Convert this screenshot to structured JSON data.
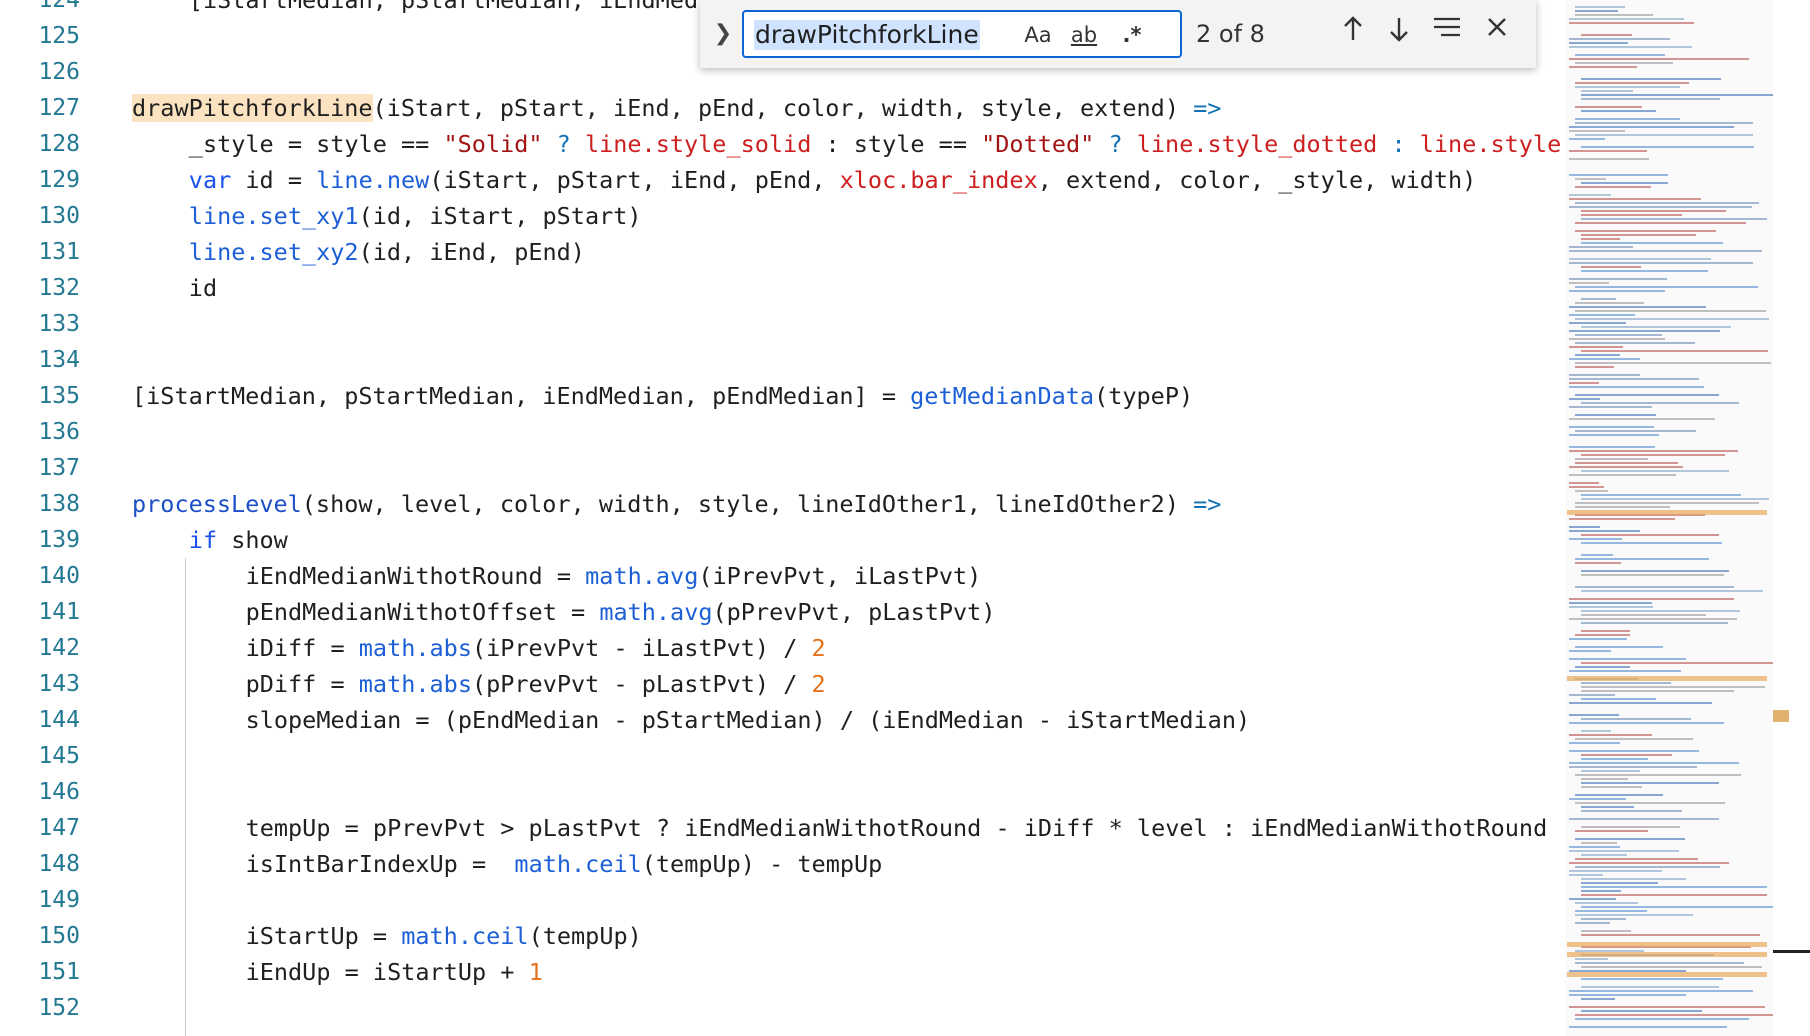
{
  "editor": {
    "lines": [
      {
        "num": "124",
        "indent": 1,
        "tokens": [
          {
            "t": "[iStartMedian, pStartMedian, iEndMed",
            "c": "cl"
          }
        ]
      },
      {
        "num": "125",
        "indent": 0,
        "tokens": []
      },
      {
        "num": "126",
        "indent": 0,
        "tokens": []
      },
      {
        "num": "127",
        "indent": 0,
        "tokens": [
          {
            "t": "drawPitchforkLine",
            "c": "hl"
          },
          {
            "t": "(iStart, pStart, iEnd, pEnd, color, width, style, extend) ",
            "c": "cl"
          },
          {
            "t": "=>",
            "c": "o"
          }
        ]
      },
      {
        "num": "128",
        "indent": 1,
        "tokens": [
          {
            "t": "_style = style == ",
            "c": "cl"
          },
          {
            "t": "\"Solid\"",
            "c": "s"
          },
          {
            "t": " ? ",
            "c": "o"
          },
          {
            "t": "line.style_solid",
            "c": "r"
          },
          {
            "t": " : style == ",
            "c": "cl"
          },
          {
            "t": "\"Dotted\"",
            "c": "s"
          },
          {
            "t": " ? ",
            "c": "o"
          },
          {
            "t": "line.style_dotted",
            "c": "r"
          },
          {
            "t": " : ",
            "c": "o"
          },
          {
            "t": "line.style",
            "c": "r"
          }
        ]
      },
      {
        "num": "129",
        "indent": 1,
        "tokens": [
          {
            "t": "var",
            "c": "k"
          },
          {
            "t": " id = ",
            "c": "cl"
          },
          {
            "t": "line.new",
            "c": "f"
          },
          {
            "t": "(iStart, pStart, iEnd, pEnd, ",
            "c": "cl"
          },
          {
            "t": "xloc.bar_index",
            "c": "r"
          },
          {
            "t": ", extend, color, _style, width)",
            "c": "cl"
          }
        ]
      },
      {
        "num": "130",
        "indent": 1,
        "tokens": [
          {
            "t": "line.set_xy1",
            "c": "f"
          },
          {
            "t": "(id, iStart, pStart)",
            "c": "cl"
          }
        ]
      },
      {
        "num": "131",
        "indent": 1,
        "tokens": [
          {
            "t": "line.set_xy2",
            "c": "f"
          },
          {
            "t": "(id, iEnd, pEnd)",
            "c": "cl"
          }
        ]
      },
      {
        "num": "132",
        "indent": 1,
        "tokens": [
          {
            "t": "id",
            "c": "cl"
          }
        ]
      },
      {
        "num": "133",
        "indent": 0,
        "tokens": []
      },
      {
        "num": "134",
        "indent": 0,
        "tokens": []
      },
      {
        "num": "135",
        "indent": 0,
        "tokens": [
          {
            "t": "[iStartMedian, pStartMedian, iEndMedian, pEndMedian] = ",
            "c": "cl"
          },
          {
            "t": "getMedianData",
            "c": "f"
          },
          {
            "t": "(typeP)",
            "c": "cl"
          }
        ]
      },
      {
        "num": "136",
        "indent": 0,
        "tokens": []
      },
      {
        "num": "137",
        "indent": 0,
        "tokens": []
      },
      {
        "num": "138",
        "indent": 0,
        "tokens": [
          {
            "t": "processLevel",
            "c": "b"
          },
          {
            "t": "(show, level, color, width, style, lineIdOther1, lineIdOther2) ",
            "c": "cl"
          },
          {
            "t": "=>",
            "c": "o"
          }
        ]
      },
      {
        "num": "139",
        "indent": 1,
        "tokens": [
          {
            "t": "if",
            "c": "k"
          },
          {
            "t": " show",
            "c": "cl"
          }
        ]
      },
      {
        "num": "140",
        "indent": 2,
        "tokens": [
          {
            "t": "iEndMedianWithotRound = ",
            "c": "cl"
          },
          {
            "t": "math.avg",
            "c": "f"
          },
          {
            "t": "(iPrevPvt, iLastPvt)",
            "c": "cl"
          }
        ]
      },
      {
        "num": "141",
        "indent": 2,
        "tokens": [
          {
            "t": "pEndMedianWithotOffset = ",
            "c": "cl"
          },
          {
            "t": "math.avg",
            "c": "f"
          },
          {
            "t": "(pPrevPvt, pLastPvt)",
            "c": "cl"
          }
        ]
      },
      {
        "num": "142",
        "indent": 2,
        "tokens": [
          {
            "t": "iDiff = ",
            "c": "cl"
          },
          {
            "t": "math.abs",
            "c": "f"
          },
          {
            "t": "(iPrevPvt - iLastPvt) / ",
            "c": "cl"
          },
          {
            "t": "2",
            "c": "n"
          }
        ]
      },
      {
        "num": "143",
        "indent": 2,
        "tokens": [
          {
            "t": "pDiff = ",
            "c": "cl"
          },
          {
            "t": "math.abs",
            "c": "f"
          },
          {
            "t": "(pPrevPvt - pLastPvt) / ",
            "c": "cl"
          },
          {
            "t": "2",
            "c": "n"
          }
        ]
      },
      {
        "num": "144",
        "indent": 2,
        "tokens": [
          {
            "t": "slopeMedian = (pEndMedian - pStartMedian) / (iEndMedian - iStartMedian)",
            "c": "cl"
          }
        ]
      },
      {
        "num": "145",
        "indent": 0,
        "tokens": []
      },
      {
        "num": "146",
        "indent": 0,
        "tokens": []
      },
      {
        "num": "147",
        "indent": 2,
        "tokens": [
          {
            "t": "tempUp = pPrevPvt > pLastPvt ? iEndMedianWithotRound - iDiff * level : iEndMedianWithotRound",
            "c": "cl"
          }
        ]
      },
      {
        "num": "148",
        "indent": 2,
        "tokens": [
          {
            "t": "isIntBarIndexUp =  ",
            "c": "cl"
          },
          {
            "t": "math.ceil",
            "c": "f"
          },
          {
            "t": "(tempUp) - tempUp",
            "c": "cl"
          }
        ]
      },
      {
        "num": "149",
        "indent": 0,
        "tokens": []
      },
      {
        "num": "150",
        "indent": 2,
        "tokens": [
          {
            "t": "iStartUp = ",
            "c": "cl"
          },
          {
            "t": "math.ceil",
            "c": "f"
          },
          {
            "t": "(tempUp)",
            "c": "cl"
          }
        ]
      },
      {
        "num": "151",
        "indent": 2,
        "tokens": [
          {
            "t": "iEndUp = iStartUp + ",
            "c": "cl"
          },
          {
            "t": "1",
            "c": "n"
          }
        ]
      },
      {
        "num": "152",
        "indent": 0,
        "tokens": []
      }
    ]
  },
  "find": {
    "query": "drawPitchforkLine",
    "match_case_label": "Aa",
    "whole_word_label": "ab",
    "regex_label": ".*",
    "count": "2 of 8",
    "icons": {
      "toggle": "chevron-right-icon",
      "prev": "arrow-up-icon",
      "next": "arrow-down-icon",
      "selection": "find-in-selection-icon",
      "close": "close-icon"
    }
  },
  "colors": {
    "accent": "#0a66d6",
    "match_highlight": "#fbe3c2",
    "line_number": "#237893"
  }
}
